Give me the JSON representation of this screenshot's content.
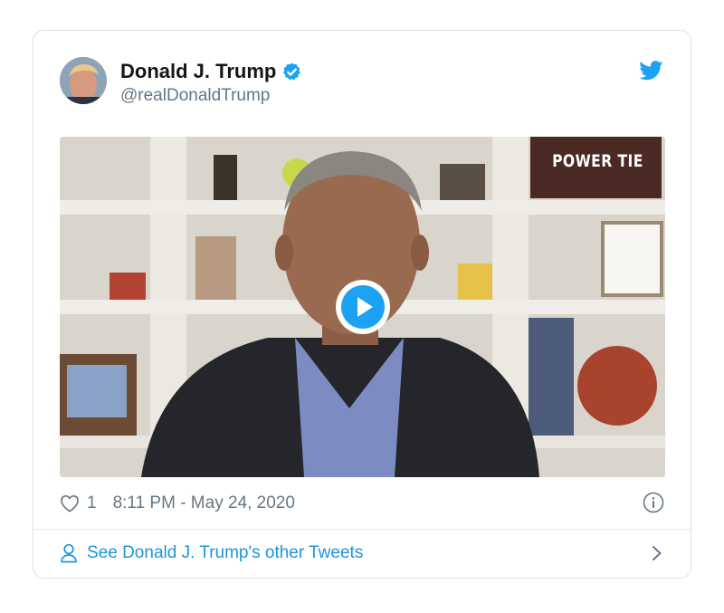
{
  "tweet": {
    "author": {
      "display_name": "Donald J. Trump",
      "handle": "@realDonaldTrump",
      "verified": true,
      "avatar_icon": "profile-photo"
    },
    "brand_icon": "twitter-bird-icon",
    "media": {
      "type": "video",
      "watermark": "POWER TIE",
      "play_icon": "play-icon"
    },
    "likes": "1",
    "timestamp": "8:11 PM - May 24, 2020",
    "info_icon": "info-icon"
  },
  "footer": {
    "link_label": "See Donald J. Trump's other Tweets",
    "person_icon": "person-icon",
    "chevron_icon": "chevron-right-icon"
  },
  "colors": {
    "accent": "#1da1f2",
    "link": "#1b95e0",
    "secondary_text": "#657786",
    "border": "#dcdfe3"
  }
}
